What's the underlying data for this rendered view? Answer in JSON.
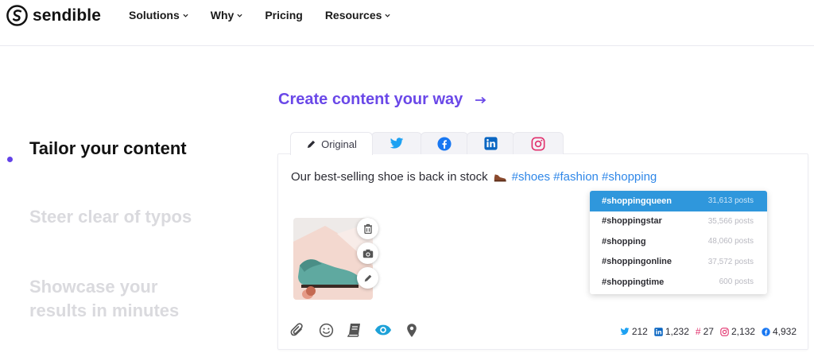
{
  "brand": {
    "name": "sendible"
  },
  "nav": {
    "items": [
      {
        "label": "Solutions",
        "has_caret": true
      },
      {
        "label": "Why",
        "has_caret": true
      },
      {
        "label": "Pricing",
        "has_caret": false
      },
      {
        "label": "Resources",
        "has_caret": true
      }
    ]
  },
  "headline": {
    "text": "Create content your way",
    "arrow": "→"
  },
  "features": [
    {
      "label": "Tailor your content",
      "active": true
    },
    {
      "label": "Steer clear of typos",
      "active": false
    },
    {
      "label": "Showcase your results in minutes",
      "active": false
    }
  ],
  "composer": {
    "tabs": [
      {
        "label": "Original",
        "icon": "pencil-icon"
      },
      {
        "label": "",
        "icon": "twitter-icon"
      },
      {
        "label": "",
        "icon": "facebook-icon"
      },
      {
        "label": "",
        "icon": "linkedin-icon"
      },
      {
        "label": "",
        "icon": "instagram-icon"
      }
    ],
    "post_text": "Our best-selling shoe is back in stock",
    "post_hashtags": "#shoes #fashion #shopping",
    "suggestions": [
      {
        "tag": "#shoppingqueen",
        "count": "31,613 posts",
        "selected": true
      },
      {
        "tag": "#shoppingstar",
        "count": "35,566 posts",
        "selected": false
      },
      {
        "tag": "#shopping",
        "count": "48,060 posts",
        "selected": false
      },
      {
        "tag": "#shoppingonline",
        "count": "37,572 posts",
        "selected": false
      },
      {
        "tag": "#shoppingtime",
        "count": "600 posts",
        "selected": false
      }
    ],
    "toolbar_icons": [
      "attach-icon",
      "emoji-icon",
      "library-icon",
      "preview-eye-icon",
      "location-icon"
    ],
    "counts": [
      {
        "network": "twitter",
        "value": "212"
      },
      {
        "network": "linkedin",
        "value": "1,232"
      },
      {
        "network": "hashtag",
        "value": "27"
      },
      {
        "network": "instagram",
        "value": "2,132"
      },
      {
        "network": "facebook",
        "value": "4,932"
      }
    ]
  },
  "colors": {
    "accent": "#6a48e8",
    "hashtag": "#2f87e8",
    "selected_row": "#2f97dc",
    "twitter": "#1da1f2",
    "facebook": "#1877f2",
    "linkedin": "#0a66c2",
    "instagram": "#e1306c",
    "inactive_text": "#dadade"
  }
}
